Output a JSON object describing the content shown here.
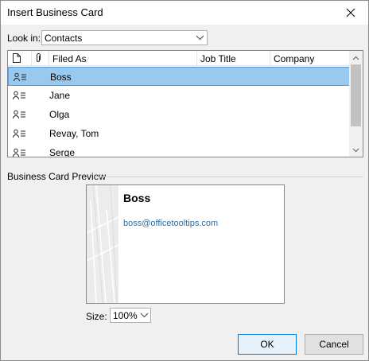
{
  "window": {
    "title": "Insert Business Card"
  },
  "look_in": {
    "label": "Look in:",
    "value": "Contacts"
  },
  "list": {
    "columns": {
      "filed_as": "Filed As",
      "job_title": "Job Title",
      "company": "Company"
    },
    "rows": [
      {
        "name": "Boss",
        "selected": true
      },
      {
        "name": "Jane",
        "selected": false
      },
      {
        "name": "Olga",
        "selected": false
      },
      {
        "name": "Revay, Tom",
        "selected": false
      },
      {
        "name": "Serge",
        "selected": false
      }
    ]
  },
  "preview": {
    "section_label": "Business Card Preview",
    "name": "Boss",
    "email": "boss@officetooltips.com"
  },
  "size": {
    "label": "Size:",
    "value": "100%"
  },
  "buttons": {
    "ok": "OK",
    "cancel": "Cancel"
  },
  "colors": {
    "selected_row": "#99c9ef",
    "link": "#2d6ca2",
    "accent": "#0078d7"
  },
  "icons": {
    "close": "close-icon",
    "header_doc": "document-icon",
    "header_attach": "paperclip-icon",
    "row": "contact-card-icon",
    "dropdown": "chevron-down-icon"
  }
}
